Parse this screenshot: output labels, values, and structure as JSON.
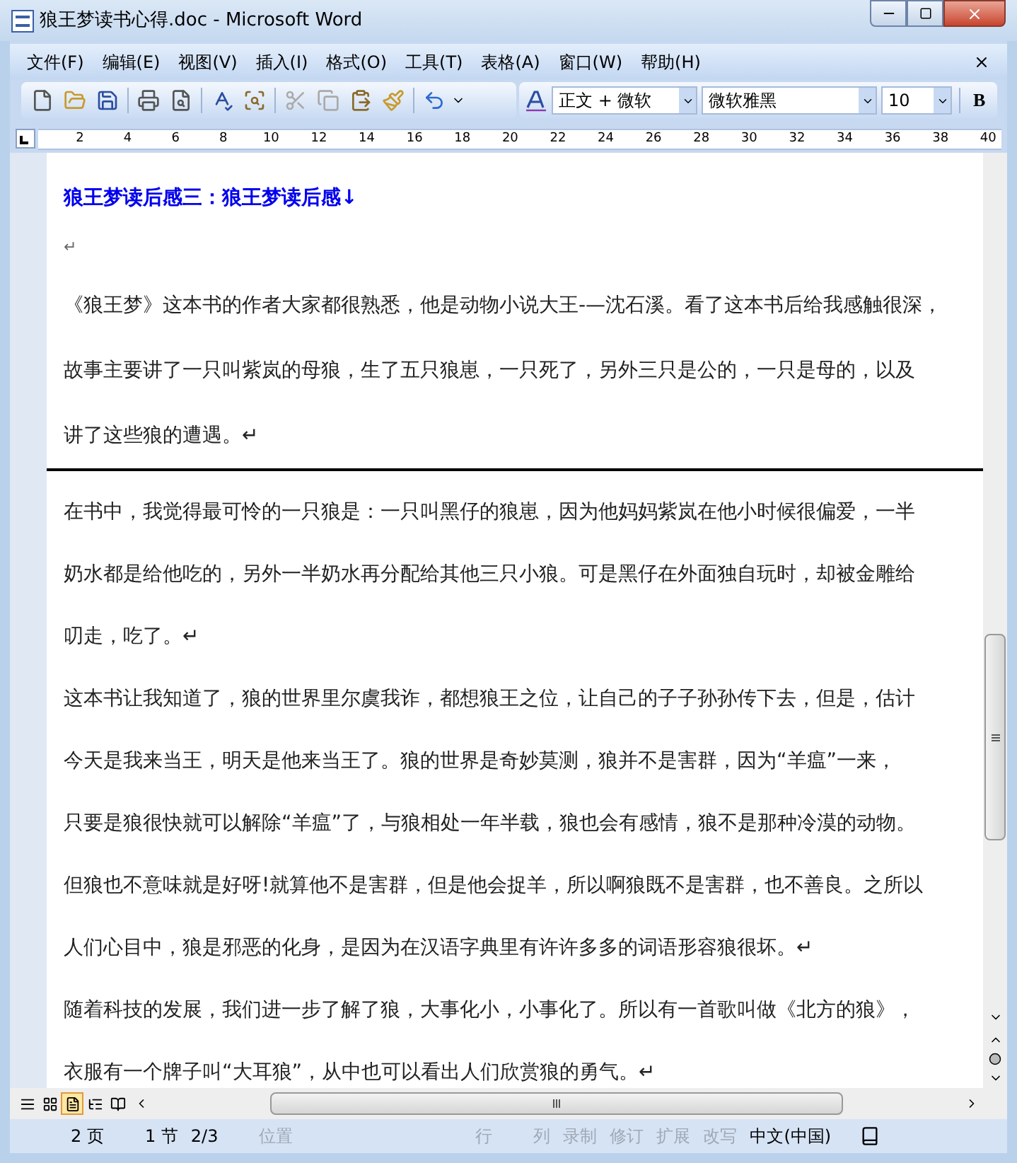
{
  "window": {
    "title": "狼王梦读书心得.doc - Microsoft Word"
  },
  "menu": [
    "文件(F)",
    "编辑(E)",
    "视图(V)",
    "插入(I)",
    "格式(O)",
    "工具(T)",
    "表格(A)",
    "窗口(W)",
    "帮助(H)"
  ],
  "toolbar": {
    "style": "正文 + 微软",
    "font": "微软雅黑",
    "size": "10",
    "bold": "B"
  },
  "ruler": [
    "2",
    "4",
    "6",
    "8",
    "10",
    "12",
    "14",
    "16",
    "18",
    "20",
    "22",
    "24",
    "26",
    "28",
    "30",
    "32",
    "34",
    "36",
    "38",
    "40"
  ],
  "pages": [
    {
      "lines": [
        {
          "kind": "heading",
          "text": "狼王梦读后感三：狼王梦读后感↓"
        },
        {
          "kind": "blank",
          "text": "↵"
        },
        {
          "kind": "text",
          "text": "《狼王梦》这本书的作者大家都很熟悉，他是动物小说大王-—沈石溪。看了这本书后给我感触很深，"
        },
        {
          "kind": "text",
          "text": "故事主要讲了一只叫紫岚的母狼，生了五只狼崽，一只死了，另外三只是公的，一只是母的，以及"
        },
        {
          "kind": "text",
          "text": "讲了这些狼的遭遇。↵"
        }
      ]
    },
    {
      "lines": [
        {
          "kind": "text",
          "text": "在书中，我觉得最可怜的一只狼是：一只叫黑仔的狼崽，因为他妈妈紫岚在他小时候很偏爱，一半"
        },
        {
          "kind": "text",
          "text": "奶水都是给他吃的，另外一半奶水再分配给其他三只小狼。可是黑仔在外面独自玩时，却被金雕给"
        },
        {
          "kind": "text",
          "text": "叨走，吃了。↵"
        },
        {
          "kind": "text",
          "text": "这本书让我知道了，狼的世界里尔虞我诈，都想狼王之位，让自己的子子孙孙传下去，但是，估计"
        },
        {
          "kind": "text",
          "text": "今天是我来当王，明天是他来当王了。狼的世界是奇妙莫测，狼并不是害群，因为“羊瘟”一来，"
        },
        {
          "kind": "text",
          "text": "只要是狼很快就可以解除“羊瘟”了，与狼相处一年半载，狼也会有感情，狼不是那种冷漠的动物。"
        },
        {
          "kind": "text",
          "text": "但狼也不意味就是好呀!就算他不是害群，但是他会捉羊，所以啊狼既不是害群，也不善良。之所以"
        },
        {
          "kind": "text",
          "text": "人们心目中，狼是邪恶的化身，是因为在汉语字典里有许许多多的词语形容狼很坏。↵"
        },
        {
          "kind": "text",
          "text": "随着科技的发展，我们进一步了解了狼，大事化小，小事化了。所以有一首歌叫做《北方的狼》，"
        },
        {
          "kind": "text",
          "text": "衣服有一个牌子叫“大耳狼”，从中也可以看出人们欣赏狼的勇气。↵"
        }
      ]
    }
  ],
  "views": [
    {
      "selected": false
    },
    {
      "selected": false
    },
    {
      "selected": true
    },
    {
      "selected": false
    },
    {
      "selected": false
    }
  ],
  "status": [
    {
      "text": "2 页",
      "disabled": false
    },
    {
      "text": "1 节",
      "disabled": false
    },
    {
      "text": "2/3",
      "disabled": false
    },
    {
      "text": "位置",
      "disabled": true
    },
    {
      "text": "行",
      "disabled": true
    },
    {
      "text": "列",
      "disabled": true
    },
    {
      "text": "录制",
      "disabled": true
    },
    {
      "text": "修订",
      "disabled": true
    },
    {
      "text": "扩展",
      "disabled": true
    },
    {
      "text": "改写",
      "disabled": true
    },
    {
      "text": "中文(中国)",
      "disabled": false
    }
  ]
}
